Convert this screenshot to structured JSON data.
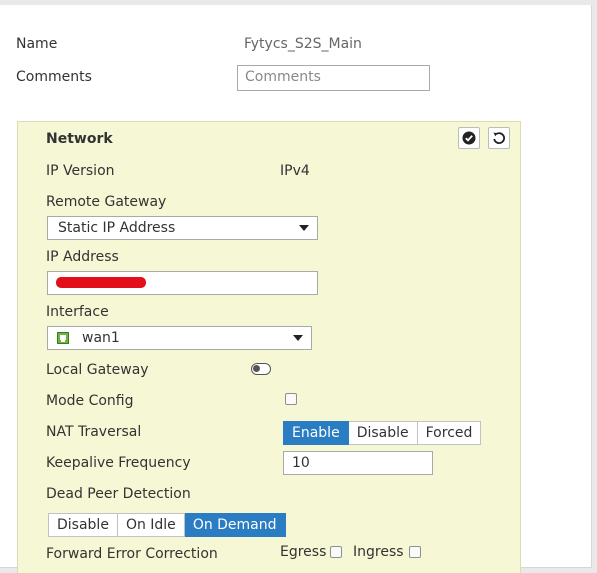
{
  "form": {
    "name_label": "Name",
    "name_value": "Fytycs_S2S_Main",
    "comments_label": "Comments",
    "comments_placeholder": "Comments"
  },
  "network": {
    "title": "Network",
    "ip_version_label": "IP Version",
    "ip_version_value": "IPv4",
    "remote_gateway_label": "Remote Gateway",
    "remote_gateway_value": "Static IP Address",
    "ip_address_label": "IP Address",
    "interface_label": "Interface",
    "interface_value": "wan1",
    "local_gateway_label": "Local Gateway",
    "mode_config_label": "Mode Config",
    "nat_traversal_label": "NAT Traversal",
    "nat_traversal_options": [
      "Enable",
      "Disable",
      "Forced"
    ],
    "nat_traversal_selected": "Enable",
    "keepalive_label": "Keepalive Frequency",
    "keepalive_value": "10",
    "dpd_label": "Dead Peer Detection",
    "dpd_options": [
      "Disable",
      "On Idle",
      "On Demand"
    ],
    "dpd_selected": "On Demand",
    "fec_label": "Forward Error Correction",
    "fec_egress_label": "Egress",
    "fec_ingress_label": "Ingress"
  },
  "icons": {
    "apply": "check-circle-icon",
    "revert": "undo-icon",
    "interface": "network-port-icon"
  },
  "colors": {
    "panel_bg": "#f6f7d4",
    "active_option": "#2a7dc3",
    "redaction": "#e3101b"
  }
}
